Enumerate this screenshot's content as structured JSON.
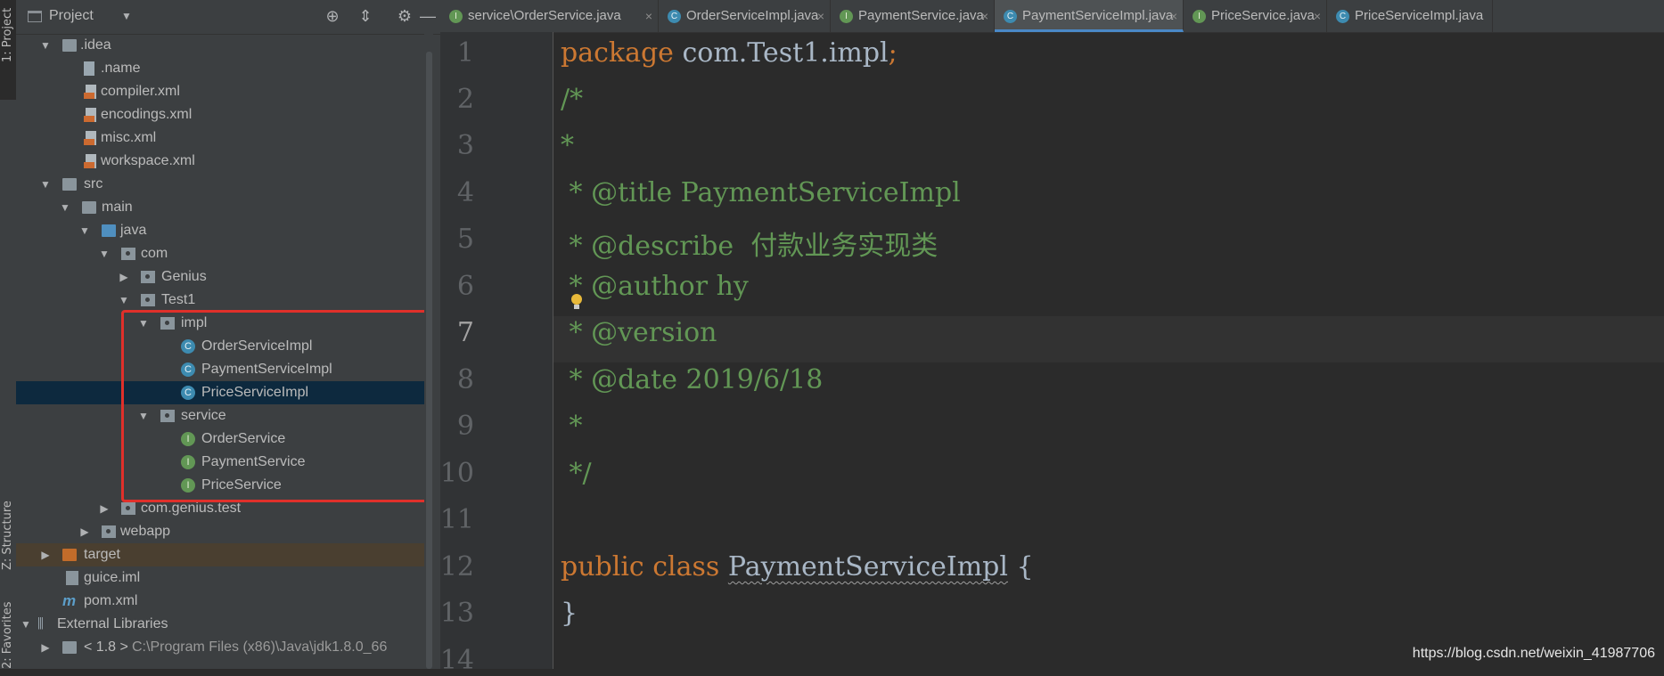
{
  "colors": {
    "background": "#2b2b2b",
    "panel": "#3c3f41",
    "selection": "#0d293e",
    "highlight_box": "#e0302a",
    "keyword": "#cc7832",
    "comment": "#629755",
    "text": "#a9b7c6"
  },
  "toolstrip": {
    "project_label": "1: Project",
    "structure_label": "Z: Structure",
    "favorites_label": "2: Favorites"
  },
  "panel": {
    "title": "Project",
    "icons": [
      "target-icon",
      "collapse-icon",
      "gear-icon",
      "minimize-icon"
    ]
  },
  "tree": [
    {
      "label": ".idea",
      "icon": "folder-icon"
    },
    {
      "label": ".name",
      "icon": "file-icon"
    },
    {
      "label": "compiler.xml",
      "icon": "xml-file-icon"
    },
    {
      "label": "encodings.xml",
      "icon": "xml-file-icon"
    },
    {
      "label": "misc.xml",
      "icon": "xml-file-icon"
    },
    {
      "label": "workspace.xml",
      "icon": "xml-file-icon"
    },
    {
      "label": "src",
      "icon": "folder-icon"
    },
    {
      "label": "main",
      "icon": "folder-icon"
    },
    {
      "label": "java",
      "icon": "source-folder-icon"
    },
    {
      "label": "com",
      "icon": "package-icon"
    },
    {
      "label": "Genius",
      "icon": "package-icon"
    },
    {
      "label": "Test1",
      "icon": "package-icon"
    },
    {
      "label": "impl",
      "icon": "package-icon"
    },
    {
      "label": "OrderServiceImpl",
      "icon": "class-icon"
    },
    {
      "label": "PaymentServiceImpl",
      "icon": "class-icon"
    },
    {
      "label": "PriceServiceImpl",
      "icon": "class-icon"
    },
    {
      "label": "service",
      "icon": "package-icon"
    },
    {
      "label": "OrderService",
      "icon": "interface-icon"
    },
    {
      "label": "PaymentService",
      "icon": "interface-icon"
    },
    {
      "label": "PriceService",
      "icon": "interface-icon"
    },
    {
      "label": "com.genius.test",
      "icon": "package-icon"
    },
    {
      "label": "webapp",
      "icon": "web-folder-icon"
    },
    {
      "label": "target",
      "icon": "excluded-folder-icon"
    },
    {
      "label": "guice.iml",
      "icon": "module-file-icon"
    },
    {
      "label": "pom.xml",
      "icon": "maven-icon"
    },
    {
      "label": "External Libraries",
      "icon": "libraries-icon"
    },
    {
      "label": "< 1.8 >",
      "path": "C:\\Program Files (x86)\\Java\\jdk1.8.0_66",
      "icon": "jdk-folder-icon"
    }
  ],
  "icon_letters": {
    "class": "C",
    "interface": "I"
  },
  "tabs": [
    {
      "label": "service\\OrderService.java",
      "kind": "interface"
    },
    {
      "label": "OrderServiceImpl.java",
      "kind": "class"
    },
    {
      "label": "PaymentService.java",
      "kind": "interface"
    },
    {
      "label": "PaymentServiceImpl.java",
      "kind": "class",
      "active": true
    },
    {
      "label": "PriceService.java",
      "kind": "interface"
    },
    {
      "label": "PriceServiceImpl.java",
      "kind": "class"
    }
  ],
  "close_glyph": "×",
  "line_numbers": [
    "1",
    "2",
    "3",
    "4",
    "5",
    "6",
    "7",
    "8",
    "9",
    "10",
    "11",
    "12",
    "13",
    "14"
  ],
  "code": {
    "l1_kw": "package",
    "l1_rest": " com.Test1.impl",
    "l1_semi": ";",
    "l2": "/*",
    "l3": "*",
    "l4": " * @title PaymentServiceImpl",
    "l5": " * @describe  付款业务实现类",
    "l6": " * @author hy",
    "l7": " * @version",
    "l8": " * @date 2019/6/18",
    "l9": " *",
    "l10": " */",
    "l12_kw": "public class",
    "l12_name": "PaymentServiceImpl",
    "l12_brace": " {",
    "l13": "}"
  },
  "watermark": "https://blog.csdn.net/weixin_41987706"
}
